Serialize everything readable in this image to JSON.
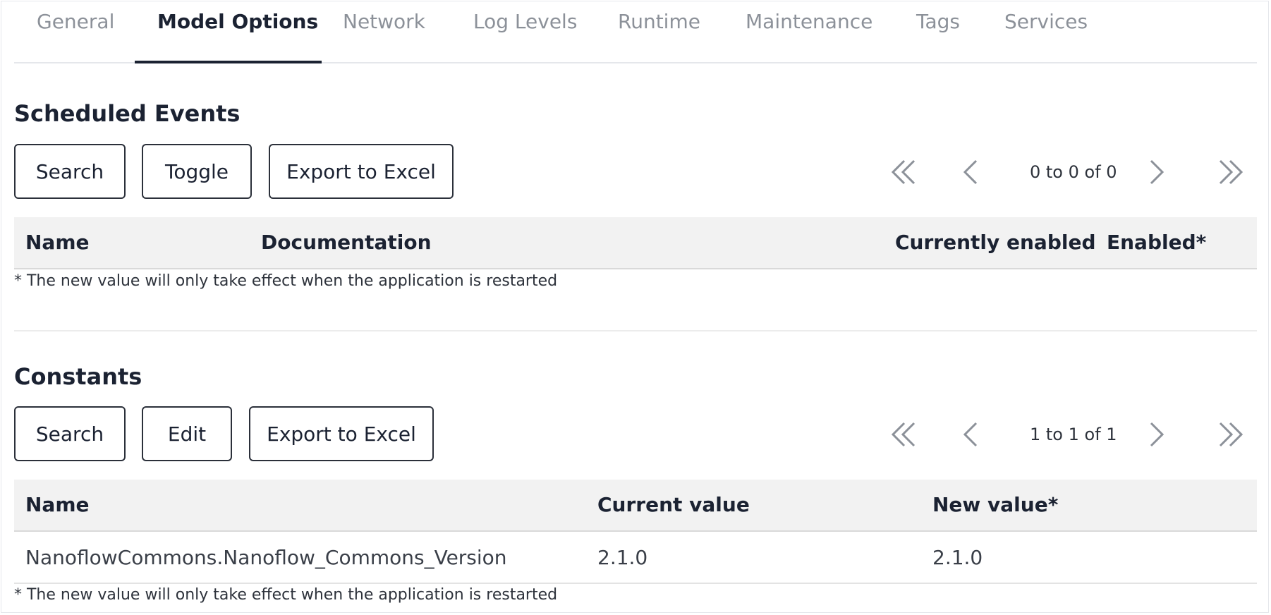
{
  "tabs": [
    {
      "label": "General"
    },
    {
      "label": "Model Options"
    },
    {
      "label": "Network"
    },
    {
      "label": "Log Levels"
    },
    {
      "label": "Runtime"
    },
    {
      "label": "Maintenance"
    },
    {
      "label": "Tags"
    },
    {
      "label": "Services"
    }
  ],
  "active_tab": "Model Options",
  "scheduled_events": {
    "title": "Scheduled Events",
    "buttons": {
      "search": "Search",
      "toggle": "Toggle",
      "export": "Export to Excel"
    },
    "pager_text": "0 to 0 of 0",
    "columns": [
      "Name",
      "Documentation",
      "Currently enabled",
      "Enabled*"
    ],
    "rows": [],
    "footnote": "* The new value will only take effect when the application is restarted"
  },
  "constants": {
    "title": "Constants",
    "buttons": {
      "search": "Search",
      "edit": "Edit",
      "export": "Export to Excel"
    },
    "pager_text": "1 to 1 of 1",
    "columns": [
      "Name",
      "Current value",
      "New value*"
    ],
    "rows": [
      {
        "name": "NanoflowCommons.Nanoflow_Commons_Version",
        "current_value": "2.1.0",
        "new_value": "2.1.0"
      }
    ],
    "footnote": "* The new value will only take effect when the application is restarted"
  },
  "icons": {
    "first": "double-chevron-left-icon",
    "prev": "chevron-left-icon",
    "next": "chevron-right-icon",
    "last": "double-chevron-right-icon"
  },
  "colors": {
    "text_dark": "#1b2232",
    "tab_inactive": "#8c9199",
    "header_bg": "#f2f2f2"
  }
}
